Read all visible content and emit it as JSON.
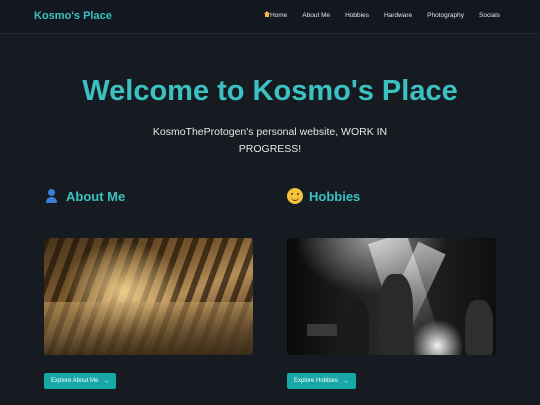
{
  "navbar": {
    "brand": "Kosmo's Place",
    "links": [
      {
        "label": "Home",
        "icon": "home-icon"
      },
      {
        "label": "About Me"
      },
      {
        "label": "Hobbies"
      },
      {
        "label": "Hardware"
      },
      {
        "label": "Photography"
      },
      {
        "label": "Socials"
      }
    ]
  },
  "hero": {
    "title": "Welcome to Kosmo's Place",
    "subtitle": "KosmoTheProtogen's personal website, WORK IN PROGRESS!"
  },
  "sections": {
    "about": {
      "heading": "About Me",
      "icon": "person-icon",
      "button": "Explore About Me",
      "button_icon": "→"
    },
    "hobbies": {
      "heading": "Hobbies",
      "icon": "smile-icon",
      "button": "Explore Hobbies",
      "button_icon": "→"
    }
  },
  "colors": {
    "background": "#161b22",
    "accent": "#3cc1c1",
    "button": "#18a7a7"
  }
}
